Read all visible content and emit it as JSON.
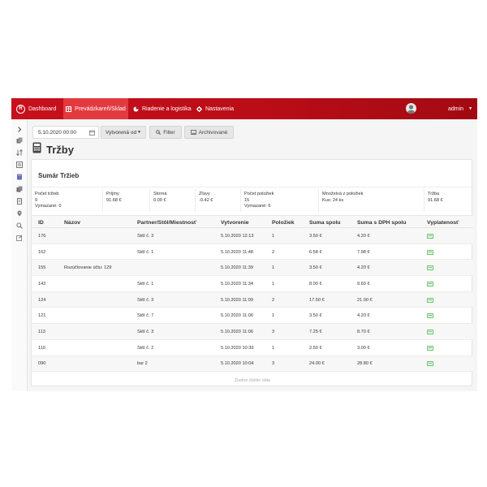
{
  "navbar": {
    "items": [
      {
        "label": "Dashboard",
        "icon": "logo-icon"
      },
      {
        "label": "Prevádzkareň/Sklad",
        "icon": "table-icon",
        "active": true
      },
      {
        "label": "Riadenie a logistika",
        "icon": "pie-chart-icon"
      },
      {
        "label": "Nastavenia",
        "icon": "gear-icon"
      }
    ],
    "user": "admin",
    "colors": {
      "bar": "#c8101c",
      "active": "#e23a3f"
    }
  },
  "sidebar": {
    "icons": [
      "chevron-right-icon",
      "copy-icon",
      "sort-icon",
      "list-icon",
      "book-icon",
      "copy-icon",
      "receipt-icon",
      "map-pin-icon",
      "search-icon",
      "edit-icon"
    ]
  },
  "toolbar": {
    "date_value": "5.10.2020 00:00",
    "select_value": "Vytvorená od",
    "filter_label": "Filter",
    "archive_label": "Archivované"
  },
  "page": {
    "title": "Tržby"
  },
  "panel": {
    "title": "Sumár Tržieb",
    "summary": [
      {
        "label": "Počet tržieb",
        "value": "9",
        "extra": "Vymazané: 0"
      },
      {
        "label": "Príjmy",
        "value": "91.68 €",
        "extra": ""
      },
      {
        "label": "Storná",
        "value": "0.00 €",
        "extra": ""
      },
      {
        "label": "Zľavy",
        "value": "-0.42 €",
        "extra": ""
      },
      {
        "label": "Počet položiek",
        "value": "15",
        "extra": "Vymazané: 6"
      },
      {
        "label": "Množstvá z položiek",
        "value": "Kus: 24 ks",
        "extra": ""
      },
      {
        "label": "Tržba",
        "value": "91.68 €",
        "extra": ""
      }
    ]
  },
  "table": {
    "columns": [
      "ID",
      "Názov",
      "Partner/Stôl/Miestnosť",
      "Vytvorenie",
      "Položiek",
      "Suma spolu",
      "Suma s DPH spolu",
      "Vyplatenosť"
    ],
    "rows": [
      {
        "id": "176",
        "nazov": "",
        "partner": "Stôl č. 3",
        "vytvorenie": "5.10.2020 12:13",
        "poloziek": "1",
        "suma": "3.50 €",
        "dph": "4.20 €"
      },
      {
        "id": "162",
        "nazov": "",
        "partner": "Stôl č. 1",
        "vytvorenie": "5.10.2020 11:48",
        "poloziek": "2",
        "suma": "6.58 €",
        "dph": "7.98 €"
      },
      {
        "id": "155",
        "nazov": "Rozúčtovanie účtu: 129",
        "partner": "",
        "vytvorenie": "5.10.2020 11:39",
        "poloziek": "1",
        "suma": "3.50 €",
        "dph": "4.20 €"
      },
      {
        "id": "142",
        "nazov": "",
        "partner": "Stôl č. 1",
        "vytvorenie": "5.10.2020 11:34",
        "poloziek": "1",
        "suma": "8.00 €",
        "dph": "9.60 €"
      },
      {
        "id": "124",
        "nazov": "",
        "partner": "Stôl č. 3",
        "vytvorenie": "5.10.2020 11:09",
        "poloziek": "2",
        "suma": "17.50 €",
        "dph": "21.00 €"
      },
      {
        "id": "121",
        "nazov": "",
        "partner": "Stôl č. 7",
        "vytvorenie": "5.10.2020 11:06",
        "poloziek": "1",
        "suma": "3.50 €",
        "dph": "4.20 €"
      },
      {
        "id": "113",
        "nazov": "",
        "partner": "Stôl č. 3",
        "vytvorenie": "5.10.2020 11:06",
        "poloziek": "3",
        "suma": "7.25 €",
        "dph": "8.70 €"
      },
      {
        "id": "110",
        "nazov": "",
        "partner": "Stôl č. 2",
        "vytvorenie": "5.10.2020 10:39",
        "poloziek": "1",
        "suma": "2.50 €",
        "dph": "3.00 €"
      },
      {
        "id": "090",
        "nazov": "",
        "partner": "bar 2",
        "vytvorenie": "5.10.2020 10:04",
        "poloziek": "3",
        "suma": "24.00 €",
        "dph": "28.80 €"
      }
    ],
    "load_more": "Žiadne ďalšie dáta"
  }
}
